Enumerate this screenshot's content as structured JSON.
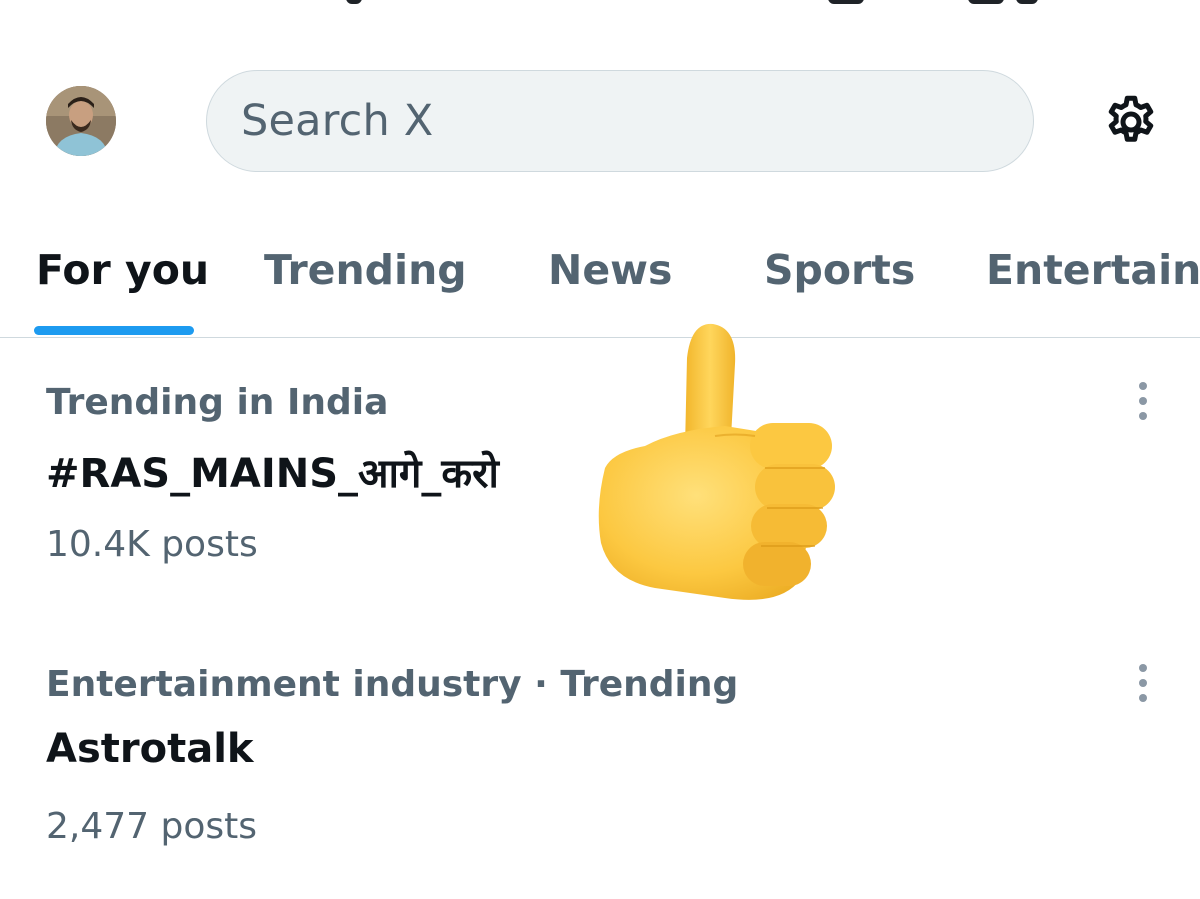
{
  "header": {
    "search_placeholder": "Search X"
  },
  "icons": {
    "avatar": "profile-avatar",
    "settings": "gear-icon",
    "more": "more-vertical-icon",
    "overlay": "thumbs-up-emoji"
  },
  "tabs": [
    {
      "label": "For you",
      "active": true
    },
    {
      "label": "Trending",
      "active": false
    },
    {
      "label": "News",
      "active": false
    },
    {
      "label": "Sports",
      "active": false
    },
    {
      "label": "Entertainment",
      "active": false
    }
  ],
  "trends": [
    {
      "context": "Trending in India",
      "title": "#RAS_MAINS_आगे_करो",
      "count": "10.4K posts"
    },
    {
      "context": "Entertainment industry · Trending",
      "title": "Astrotalk",
      "count": "2,477 posts"
    }
  ],
  "colors": {
    "accent": "#1d9bf0",
    "primary_text": "#0f1419",
    "secondary_text": "#536471",
    "search_bg": "#eff3f4",
    "divider": "#cfd9de"
  }
}
